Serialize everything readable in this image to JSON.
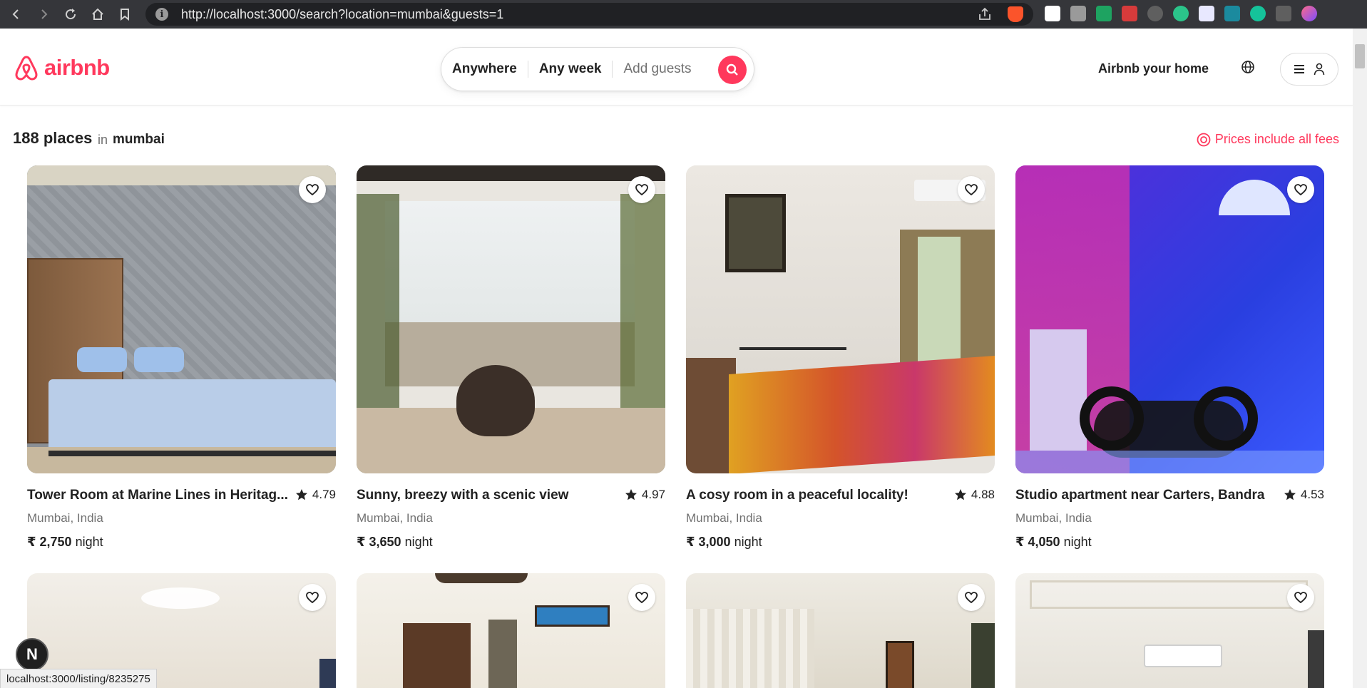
{
  "browser": {
    "url": "http://localhost:3000/search?location=mumbai&guests=1",
    "status_url": "localhost:3000/listing/8235275"
  },
  "header": {
    "logo_text": "airbnb",
    "search": {
      "where": "Anywhere",
      "when": "Any week",
      "guests_placeholder": "Add guests"
    },
    "host_link": "Airbnb your home"
  },
  "results": {
    "count_label": "188 places",
    "in_label": "in",
    "location": "mumbai",
    "fees_note": "Prices include all fees"
  },
  "listings": [
    {
      "title": "Tower Room at Marine Lines in Heritag...",
      "rating": "4.79",
      "location": "Mumbai, India",
      "price": "₹ 2,750",
      "unit": "night"
    },
    {
      "title": "Sunny, breezy with a scenic view",
      "rating": "4.97",
      "location": "Mumbai, India",
      "price": "₹ 3,650",
      "unit": "night"
    },
    {
      "title": "A cosy room in a peaceful locality!",
      "rating": "4.88",
      "location": "Mumbai, India",
      "price": "₹ 3,000",
      "unit": "night"
    },
    {
      "title": "Studio apartment near Carters, Bandra",
      "rating": "4.53",
      "location": "Mumbai, India",
      "price": "₹ 4,050",
      "unit": "night"
    }
  ],
  "overlay": {
    "avatar_letter": "N"
  },
  "colors": {
    "brand": "#ff385c",
    "text": "#222222",
    "muted": "#717171"
  }
}
